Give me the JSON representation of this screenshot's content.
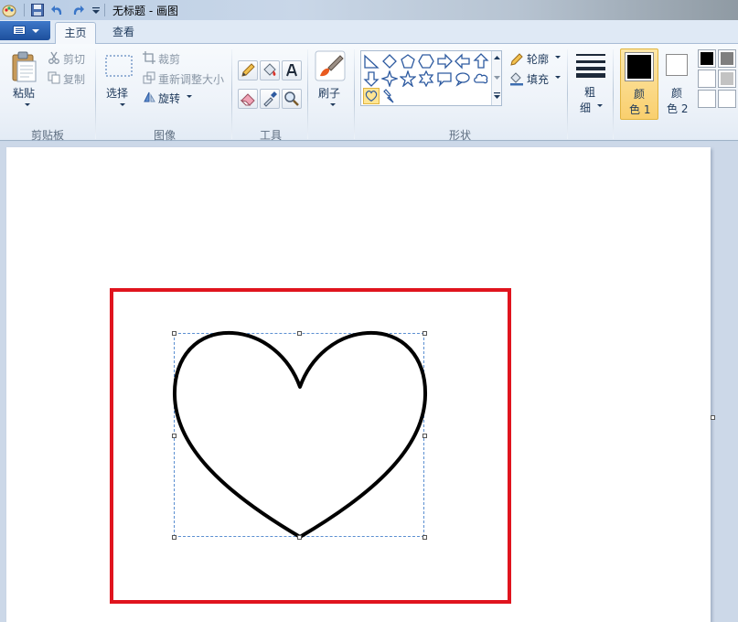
{
  "window": {
    "title": "无标题 - 画图"
  },
  "tabs": [
    {
      "label": "主页",
      "active": true
    },
    {
      "label": "查看",
      "active": false
    }
  ],
  "ribbon": {
    "clipboard": {
      "group_label": "剪贴板",
      "paste_label": "粘贴",
      "cut_label": "剪切",
      "copy_label": "复制"
    },
    "image": {
      "group_label": "图像",
      "select_label": "选择",
      "crop_label": "裁剪",
      "resize_label": "重新调整大小",
      "rotate_label": "旋转"
    },
    "tools": {
      "group_label": "工具"
    },
    "brushes": {
      "label": "刷子"
    },
    "shapes": {
      "group_label": "形状",
      "outline_label": "轮廓",
      "fill_label": "填充"
    },
    "size": {
      "label_line1": "粗",
      "label_line2": "细"
    },
    "colors": {
      "color1_line1": "颜",
      "color1_line2": "色 1",
      "color2_line1": "颜",
      "color2_line2": "色 2",
      "color1_value": "#000000",
      "color2_value": "#ffffff",
      "palette": [
        "#000000",
        "#7f7f7f",
        "#ffffff",
        "#c3c3c3",
        "#ffffff",
        "#ffffff"
      ]
    }
  },
  "accent_colors": {
    "highlight": "#e0141e",
    "selection": "#ffe592",
    "file_button": "#1d4f9c"
  }
}
